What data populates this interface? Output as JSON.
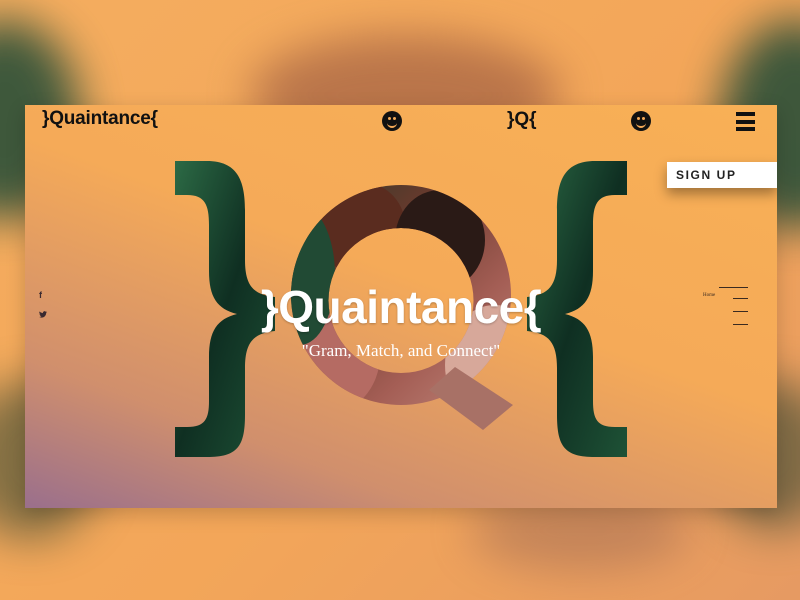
{
  "app": {
    "logo": "}Quaintance{",
    "mark": "}Q{",
    "hero_title": "}Quaintance{",
    "tagline": "\"Gram, Match, and Connect\""
  },
  "nav": {
    "signup_label": "SIGN UP",
    "home_label": "Home"
  },
  "social": {
    "facebook": "f",
    "twitter": "🐦"
  },
  "icons": [
    "smiley-icon",
    "hamburger-icon",
    "facebook-icon",
    "twitter-icon"
  ],
  "colors": {
    "background": "#f5aa58",
    "text_dark": "#111111",
    "foliage": "#1f4a36",
    "accent_purple": "#9a6f8c"
  }
}
